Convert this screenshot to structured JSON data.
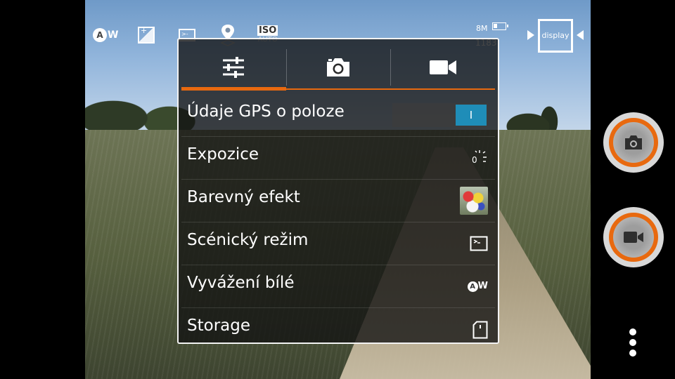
{
  "status_bar": {
    "awb_letter": "A",
    "awb_suffix": "W",
    "iso_label": "ISO",
    "iso_value": "AUTO",
    "resolution": "8M",
    "shots_remaining": "1183",
    "display_label": "display"
  },
  "tabs": [
    {
      "icon": "sliders-icon",
      "active": true
    },
    {
      "icon": "camera-icon",
      "active": false
    },
    {
      "icon": "video-camera-icon",
      "active": false
    }
  ],
  "settings": {
    "gps": {
      "label": "Údaje GPS o poloze",
      "toggle_text": "I",
      "enabled": true
    },
    "exposure": {
      "label": "Expozice",
      "icon_value": "0"
    },
    "color_effect": {
      "label": "Barevný efekt"
    },
    "scene_mode": {
      "label": "Scénický režim"
    },
    "white_balance": {
      "label": "Vyvážení bílé",
      "icon_letter": "A",
      "icon_suffix": "W"
    },
    "storage": {
      "label": "Storage"
    }
  },
  "colors": {
    "accent": "#e8690f",
    "toggle_on": "#1f8db8"
  }
}
